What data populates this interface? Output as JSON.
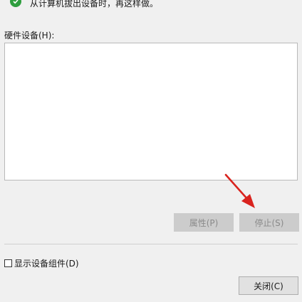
{
  "top_note": {
    "text": "从计算机拔出设备时，再这样做。"
  },
  "hardware": {
    "label": "硬件设备(H):"
  },
  "buttons": {
    "properties": "属性(P)",
    "stop": "停止(S)",
    "close": "关闭(C)"
  },
  "options": {
    "show_components_label": "显示设备组件(D)",
    "show_components_checked": false
  },
  "colors": {
    "background": "#f0f0f0",
    "list_background": "#ffffff",
    "disabled_button": "#cccccc",
    "check_green": "#2e9e3e",
    "annotation_arrow": "#d9231e"
  },
  "icons": {
    "status": "check-circle-icon",
    "annotation": "red-arrow-icon"
  }
}
